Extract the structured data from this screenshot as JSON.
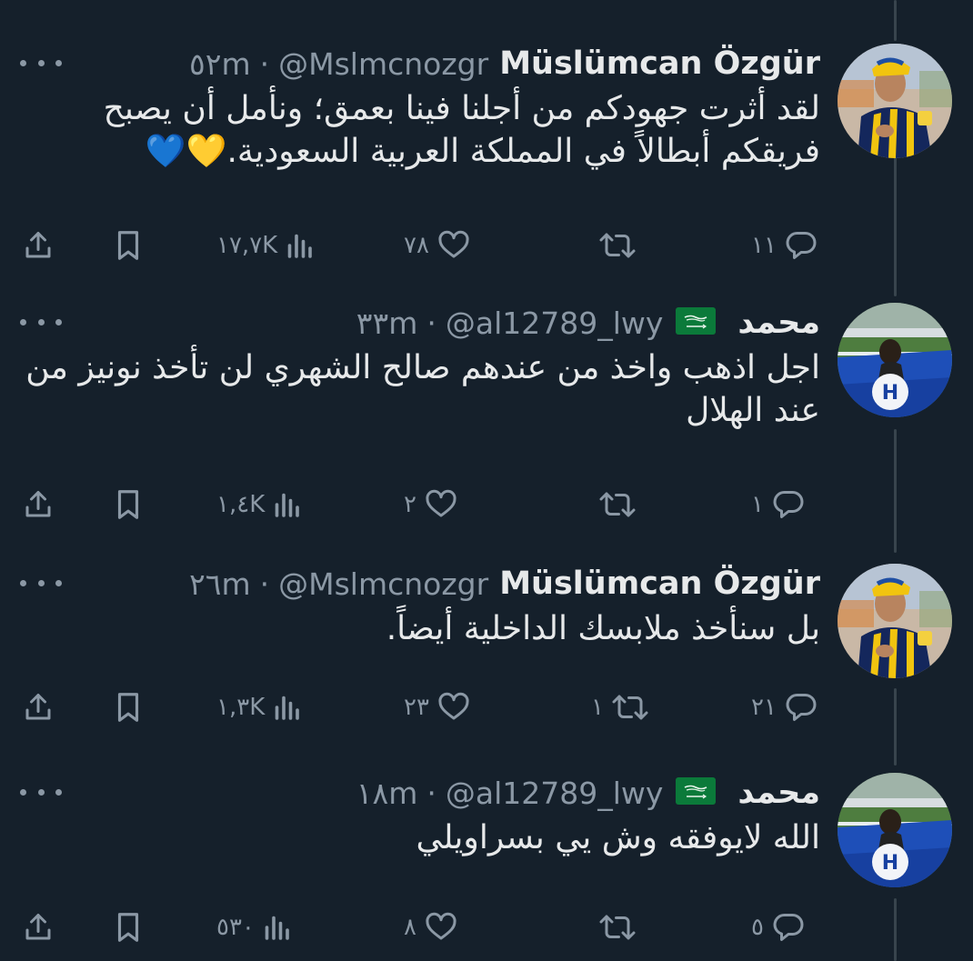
{
  "tweets": [
    {
      "name": "Müslümcan Özgür",
      "handle": "@Mslmcnozgr",
      "time": "٥٢m",
      "flag": false,
      "avatar": "avatar-fenerbahce-player",
      "text": "لقد أثرت جهودكم من أجلنا فينا بعمق؛ ونأمل أن يصبح فريقكم أبطالاً في المملكة العربية السعودية.💛💙",
      "replies": "١١",
      "retweets": "",
      "likes": "٧٨",
      "views": "١٧,٧K"
    },
    {
      "name": "محمد",
      "handle": "@al12789_lwy",
      "time": "٣٣m",
      "flag": true,
      "avatar": "avatar-alhilal-fan",
      "text": "اجل اذهب واخذ من عندهم صالح الشهري لن تأخذ نونيز من عند الهلال",
      "replies": "١",
      "retweets": "",
      "likes": "٢",
      "views": "١,٤K"
    },
    {
      "name": "Müslümcan Özgür",
      "handle": "@Mslmcnozgr",
      "time": "٢٦m",
      "flag": false,
      "avatar": "avatar-fenerbahce-player",
      "text": "بل سنأخذ ملابسك الداخلية أيضاً.",
      "replies": "٢١",
      "retweets": "١",
      "likes": "٢٣",
      "views": "١,٣K"
    },
    {
      "name": "محمد",
      "handle": "@al12789_lwy",
      "time": "١٨m",
      "flag": true,
      "avatar": "avatar-alhilal-fan",
      "text": "الله لايوفقه وش يي بسراويلي",
      "replies": "٥",
      "retweets": "",
      "likes": "٨",
      "views": "٥٣٠"
    }
  ],
  "colors": {
    "background": "#15202b",
    "text": "#e7e9ea",
    "muted": "#8b98a5",
    "thread_line": "#38444d"
  },
  "icons": [
    "more-icon",
    "saudi-flag-icon",
    "reply-icon",
    "retweet-icon",
    "like-icon",
    "views-icon",
    "bookmark-icon",
    "share-icon"
  ]
}
